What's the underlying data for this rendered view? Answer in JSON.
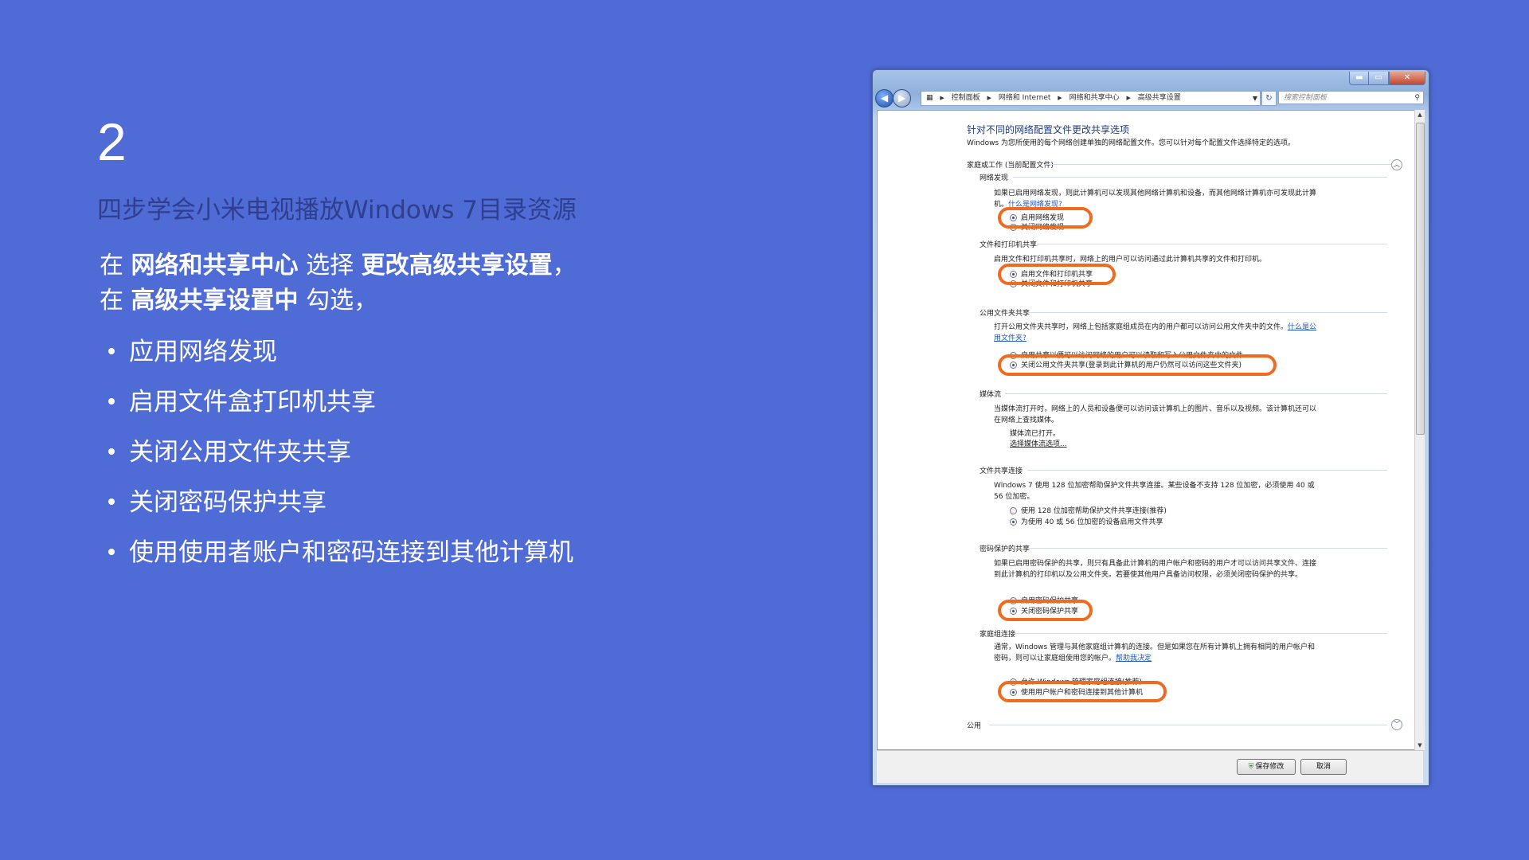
{
  "slide": {
    "step_number": "2",
    "subtitle": "四步学会小米电视播放Windows 7目录资源",
    "intro_line1": {
      "p1": "在 ",
      "b1": "网络和共享中心",
      "p2": " 选择 ",
      "b2": "更改高级共享设置",
      "p3": "，"
    },
    "intro_line2": {
      "p1": "在 ",
      "b1": "高级共享设置中",
      "p2": " 勾选，"
    },
    "bullets": [
      "应用网络发现",
      "启用文件盒打印机共享",
      "关闭公用文件夹共享",
      "关闭密码保护共享",
      "使用使用者账户和密码连接到其他计算机"
    ]
  },
  "window": {
    "controls": {
      "minimize": "▬",
      "maximize": "▭",
      "close": "✕"
    },
    "address": {
      "breadcrumbs": [
        "控制面板",
        "网络和 Internet",
        "网络和共享中心",
        "高级共享设置"
      ],
      "separator": "▶",
      "dropdown": "▼"
    },
    "refresh_icon": "↻",
    "search_placeholder": "搜索控制面板",
    "page_title": "针对不同的网络配置文件更改共享选项",
    "page_desc": "Windows 为您所使用的每个网络创建单独的网络配置文件。您可以针对每个配置文件选择特定的选项。",
    "profile_home": "家庭或工作 (当前配置文件)",
    "profile_public": "公用",
    "sections": {
      "discovery": {
        "title": "网络发现",
        "text": "如果已启用网络发现，则此计算机可以发现其他网络计算机和设备，而其他网络计算机亦可发现此计算机。",
        "link": "什么是网络发现?",
        "opt_on": "启用网络发现",
        "opt_off": "关闭网络发现"
      },
      "printer": {
        "title": "文件和打印机共享",
        "text": "启用文件和打印机共享时，网络上的用户可以访问通过此计算机共享的文件和打印机。",
        "opt_on": "启用文件和打印机共享",
        "opt_off": "关闭文件和打印机共享"
      },
      "public_folder": {
        "title": "公用文件夹共享",
        "text": "打开公用文件夹共享时，网络上包括家庭组成员在内的用户都可以访问公用文件夹中的文件。",
        "link": "什么是公用文件夹?",
        "opt_on": "启用共享以便可以访问网络的用户可以读取和写入公用文件夹中的文件",
        "opt_off": "关闭公用文件夹共享(登录到此计算机的用户仍然可以访问这些文件夹)"
      },
      "media": {
        "title": "媒体流",
        "text": "当媒体流打开时，网络上的人员和设备便可以访问该计算机上的图片、音乐以及视频。该计算机还可以在网络上查找媒体。",
        "status": "媒体流已打开。",
        "link": "选择媒体流选项..."
      },
      "connections": {
        "title": "文件共享连接",
        "text": "Windows 7 使用 128 位加密帮助保护文件共享连接。某些设备不支持 128 位加密，必须使用 40 或 56 位加密。",
        "opt_128": "使用 128 位加密帮助保护文件共享连接(推荐)",
        "opt_40": "为使用 40 或 56 位加密的设备启用文件共享"
      },
      "password": {
        "title": "密码保护的共享",
        "text": "如果已启用密码保护的共享，则只有具备此计算机的用户帐户和密码的用户才可以访问共享文件、连接到此计算机的打印机以及公用文件夹。若要使其他用户具备访问权限，必须关闭密码保护的共享。",
        "opt_on": "启用密码保护共享",
        "opt_off": "关闭密码保护共享"
      },
      "homegroup": {
        "title": "家庭组连接",
        "text": "通常，Windows 管理与其他家庭组计算机的连接。但是如果您在所有计算机上拥有相同的用户帐户和密码，则可以让家庭组使用您的帐户。",
        "link": "帮助我决定",
        "opt_windows": "允许 Windows 管理家庭组连接(推荐)",
        "opt_user": "使用用户帐户和密码连接到其他计算机"
      }
    },
    "collapse_icon": "︿",
    "expand_icon": "﹀",
    "buttons": {
      "save": "保存修改",
      "cancel": "取消"
    },
    "highlight_color": "#f06a1f",
    "background_color": "#4f6bd6"
  }
}
